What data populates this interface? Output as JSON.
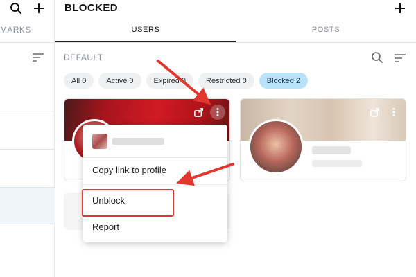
{
  "header": {
    "title": "BLOCKED",
    "add_icon": "plus-icon"
  },
  "left_rail": {
    "search_icon": "search-icon",
    "add_icon": "plus-icon",
    "tab_label": "MARKS"
  },
  "tabs": [
    {
      "label": "USERS",
      "active": true
    },
    {
      "label": "POSTS",
      "active": false
    }
  ],
  "list": {
    "section_label": "DEFAULT",
    "search_icon": "search-icon",
    "sort_icon": "sort-icon"
  },
  "filters": [
    {
      "label": "All 0",
      "active": false
    },
    {
      "label": "Active 0",
      "active": false
    },
    {
      "label": "Expired 0",
      "active": false
    },
    {
      "label": "Restricted 0",
      "active": false
    },
    {
      "label": "Blocked 2",
      "active": true
    }
  ],
  "cards": [
    {
      "share_icon": "share-icon",
      "more_icon": "more-vertical-icon"
    },
    {
      "share_icon": "share-icon",
      "more_icon": "more-vertical-icon"
    }
  ],
  "menu": {
    "items": [
      {
        "label": "Copy link to profile"
      },
      {
        "label": "Unblock"
      },
      {
        "label": "Report"
      }
    ]
  },
  "colors": {
    "accent_chip": "#b9e2f8",
    "annotation": "#e2372f"
  }
}
